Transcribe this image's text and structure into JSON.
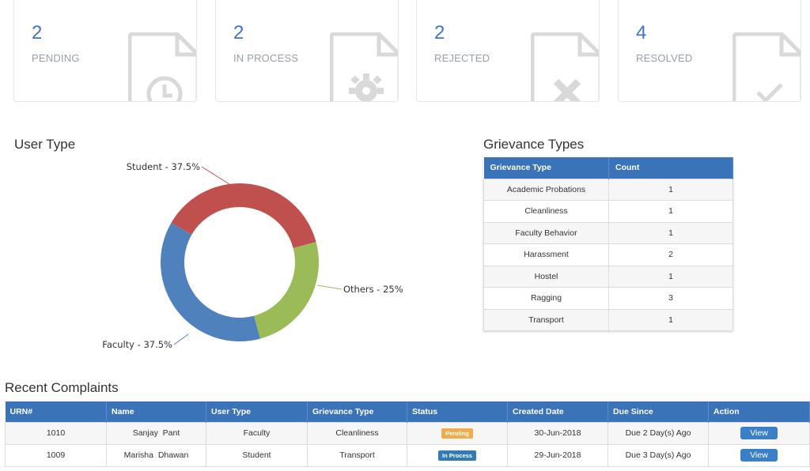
{
  "stats": [
    {
      "value": "2",
      "label": "PENDING",
      "icon": "clock-file-icon"
    },
    {
      "value": "2",
      "label": "IN PROCESS",
      "icon": "gear-file-icon"
    },
    {
      "value": "2",
      "label": "REJECTED",
      "icon": "x-file-icon"
    },
    {
      "value": "4",
      "label": "RESOLVED",
      "icon": "check-file-icon"
    }
  ],
  "user_type": {
    "title": "User Type",
    "chart_data": {
      "type": "pie",
      "donut": true,
      "slices": [
        {
          "label": "Student - 37.5%",
          "value": 37.5,
          "color": "#c0504d"
        },
        {
          "label": "Others - 25%",
          "value": 25,
          "color": "#9bbb59"
        },
        {
          "label": "Faculty - 37.5%",
          "value": 37.5,
          "color": "#4f81bd"
        }
      ]
    }
  },
  "grievance_types": {
    "title": "Grievance Types",
    "headers": [
      "Grievance Type",
      "Count"
    ],
    "rows": [
      [
        "Academic Probations",
        "1"
      ],
      [
        "Cleanliness",
        "1"
      ],
      [
        "Faculty Behavior",
        "1"
      ],
      [
        "Harassment",
        "2"
      ],
      [
        "Hostel",
        "1"
      ],
      [
        "Ragging",
        "3"
      ],
      [
        "Transport",
        "1"
      ]
    ]
  },
  "recent": {
    "title": "Recent Complaints",
    "headers": [
      "URN#",
      "Name",
      "User Type",
      "Grievance Type",
      "Status",
      "Created Date",
      "Due Since",
      "Action"
    ],
    "rows": [
      {
        "urn": "1010",
        "name": "Sanjay  Pant",
        "user_type": "Faculty",
        "grievance": "Cleanliness",
        "status": "Pending",
        "status_color": "#f0ad4e",
        "created": "30-Jun-2018",
        "due": "Due 2 Day(s) Ago",
        "action": "View"
      },
      {
        "urn": "1009",
        "name": "Marisha  Dhawan",
        "user_type": "Student",
        "grievance": "Transport",
        "status": "In Process",
        "status_color": "#337ab7",
        "created": "29-Jun-2018",
        "due": "Due 3 Day(s) Ago",
        "action": "View"
      }
    ]
  },
  "colors": {
    "accent": "#3f74c6",
    "table_header": "#3a73b8",
    "icon_gray": "#d9d9d9"
  }
}
